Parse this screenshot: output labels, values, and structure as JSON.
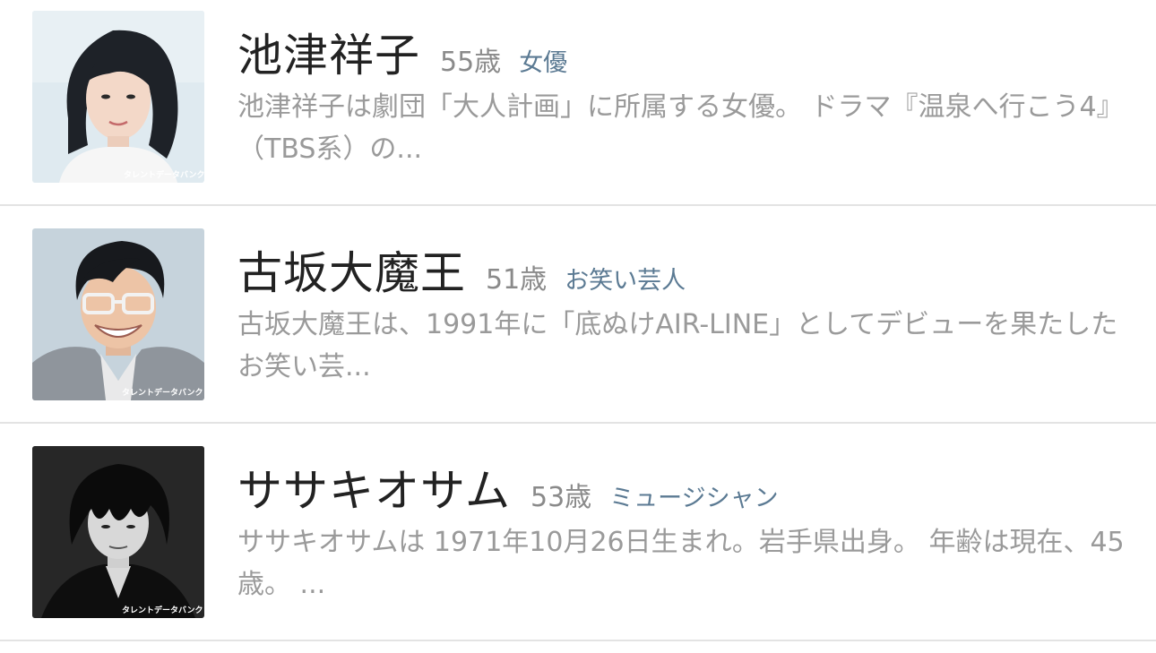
{
  "people": [
    {
      "name": "池津祥子",
      "age": "55歳",
      "role": "女優",
      "description": "池津祥子は劇団「大人計画」に所属する女優。 ドラマ『温泉へ行こう4』（TBS系）の...",
      "photo_watermark": "タレントデータバンク"
    },
    {
      "name": "古坂大魔王",
      "age": "51歳",
      "role": "お笑い芸人",
      "description": "古坂大魔王は、1991年に「底ぬけAIR-LINE」としてデビューを果たしたお笑い芸...",
      "photo_watermark": "タレントデータバンク"
    },
    {
      "name": "ササキオサム",
      "age": "53歳",
      "role": "ミュージシャン",
      "description": "ササキオサムは 1971年10月26日生まれ。岩手県出身。 年齢は現在、45歳。 ...",
      "photo_watermark": "タレントデータバンク"
    }
  ],
  "colors": {
    "name": "#222222",
    "age": "#8a8a8a",
    "role": "#5b7a93",
    "description": "#9a9a9a",
    "divider": "#e3e3e3"
  }
}
